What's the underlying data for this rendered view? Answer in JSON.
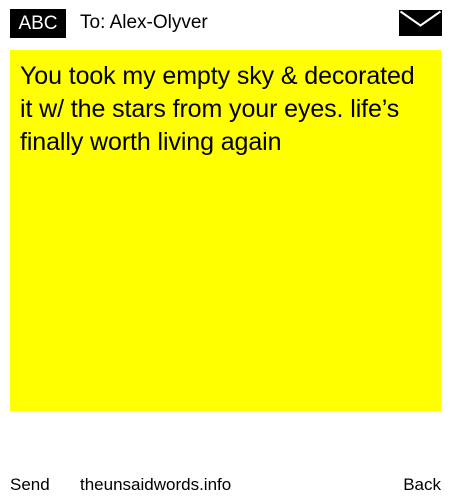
{
  "header": {
    "badge": "ABC",
    "recipient": "To: Alex-Olyver",
    "envelope_icon": "envelope-icon"
  },
  "note": {
    "background": "#ffff00",
    "message": "You took my empty sky & decorated it w/ the stars from your eyes. life’s finally worth living again"
  },
  "footer": {
    "send_label": "Send",
    "site_label": "theunsaidwords.info",
    "back_label": "Back"
  }
}
